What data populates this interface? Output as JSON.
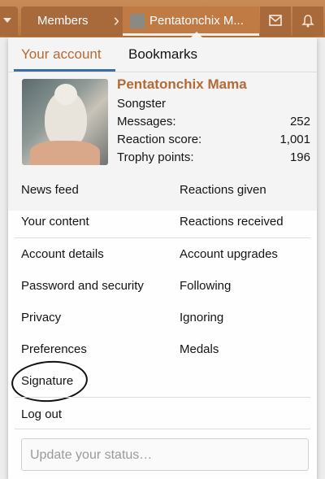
{
  "nav": {
    "members_label": "Members",
    "separator": "›",
    "account_label": "Pentatonchix M..."
  },
  "menu": {
    "tabs": [
      {
        "label": "Your account",
        "active": true
      },
      {
        "label": "Bookmarks",
        "active": false
      }
    ],
    "profile": {
      "username": "Pentatonchix Mama",
      "user_title": "Songster",
      "stats": [
        {
          "label": "Messages:",
          "value": "252"
        },
        {
          "label": "Reaction score:",
          "value": "1,001"
        },
        {
          "label": "Trophy points:",
          "value": "196"
        }
      ]
    },
    "links_group1": {
      "news_feed": "News feed",
      "reactions_given": "Reactions given",
      "your_content": "Your content",
      "reactions_received": "Reactions received"
    },
    "links_group2": {
      "account_details": "Account details",
      "account_upgrades": "Account upgrades",
      "password_security": "Password and security",
      "following": "Following",
      "privacy": "Privacy",
      "ignoring": "Ignoring",
      "preferences": "Preferences",
      "medals": "Medals",
      "signature": "Signature"
    },
    "logout": "Log out",
    "status_placeholder": "Update your status…"
  },
  "colors": {
    "nav_bar": "#b57440",
    "accent_link": "#b56a35",
    "tab_underline": "#3b6ea8"
  },
  "icons": [
    "caret-down-icon",
    "envelope-icon",
    "bell-icon"
  ]
}
